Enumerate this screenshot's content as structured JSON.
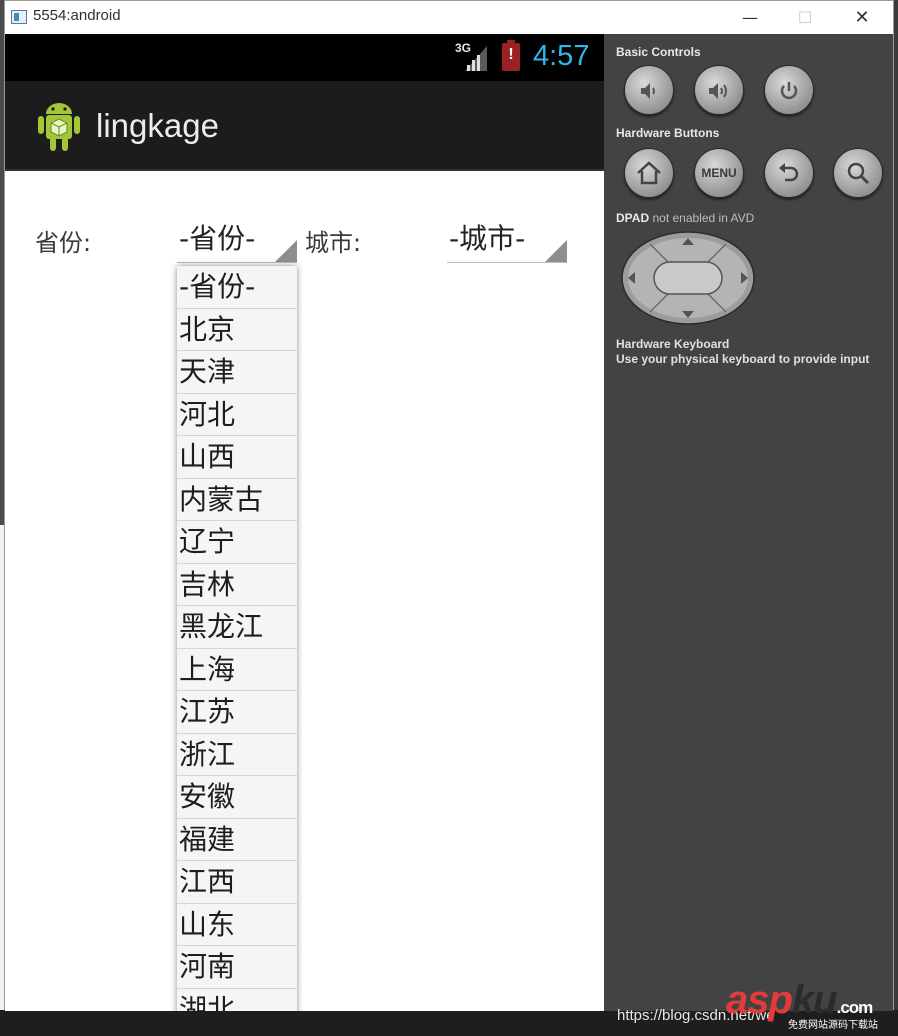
{
  "window": {
    "title": "5554:android",
    "minimize": "—",
    "maximize": "☐",
    "close": "✕"
  },
  "status_bar": {
    "network": "3G",
    "battery_alert": "!",
    "time": "4:57"
  },
  "action_bar": {
    "title": "lingkage"
  },
  "form": {
    "province_label": "省份:",
    "province_value": "-省份-",
    "city_label": "城市:",
    "city_value": "-城市-"
  },
  "province_options": [
    "-省份-",
    "北京",
    "天津",
    "河北",
    "山西",
    "内蒙古",
    "辽宁",
    "吉林",
    "黑龙江",
    "上海",
    "江苏",
    "浙江",
    "安徽",
    "福建",
    "江西",
    "山东",
    "河南",
    "湖北"
  ],
  "controls": {
    "basic_label": "Basic Controls",
    "hardware_label": "Hardware Buttons",
    "dpad_label": "DPAD",
    "dpad_note": "not enabled in AVD",
    "keyboard_label": "Hardware Keyboard",
    "keyboard_note": "Use your physical keyboard to provide input",
    "menu_label": "MENU"
  },
  "footer": {
    "url": "https://blog.csdn.net/we",
    "watermark_a": "asp",
    "watermark_b": "ku",
    "watermark_c": ".com",
    "watermark_sub": "免费网站源码下载站"
  },
  "colors": {
    "clock": "#33b5e5",
    "android_green": "#a4c639",
    "battery_alert": "#9a2222"
  }
}
